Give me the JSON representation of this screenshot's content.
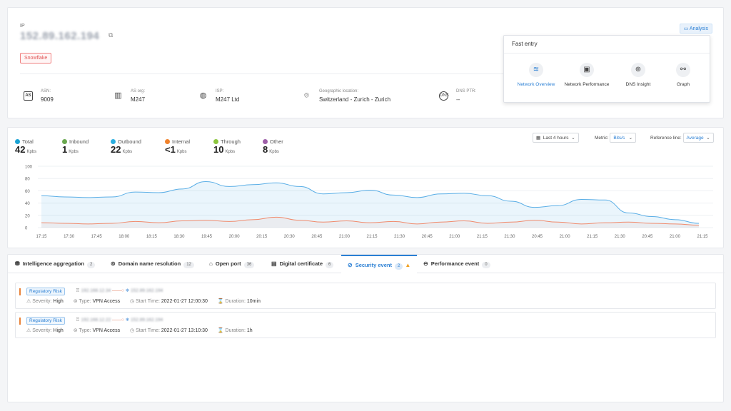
{
  "top": {
    "ip_label": "IP",
    "ip_value": "152.89.162.194",
    "tag": "Snowflake",
    "analysis_label": "Analysis",
    "info": [
      {
        "label": "ASN:",
        "value": "9009"
      },
      {
        "label": "AS org:",
        "value": "M247"
      },
      {
        "label": "ISP:",
        "value": "M247 Ltd"
      },
      {
        "label": "Geographic location:",
        "value": "Switzerland - Zurich - Zurich"
      },
      {
        "label": "DNS PTR:",
        "value": "--"
      }
    ],
    "fast_entry": {
      "title": "Fast entry",
      "items": [
        {
          "label": "Network Overview",
          "active": true
        },
        {
          "label": "Network Performance",
          "active": false
        },
        {
          "label": "DNS Insight",
          "active": false
        },
        {
          "label": "Graph",
          "active": false
        }
      ]
    }
  },
  "traffic": {
    "legend": [
      {
        "name": "Total",
        "value": "42",
        "unit": "Kpbs",
        "color": "#1aa3d4"
      },
      {
        "name": "Inbound",
        "value": "1",
        "unit": "Kpbs",
        "color": "#6aa84f"
      },
      {
        "name": "Outbound",
        "value": "22",
        "unit": "Kpbs",
        "color": "#29aee0"
      },
      {
        "name": "Internal",
        "value": "<1",
        "unit": "Kpbs",
        "color": "#f0822c"
      },
      {
        "name": "Through",
        "value": "10",
        "unit": "Kpbs",
        "color": "#8cc63e"
      },
      {
        "name": "Other",
        "value": "8",
        "unit": "Kpbs",
        "color": "#9e5fa8"
      }
    ],
    "controls": {
      "time_range": "Last 4 hours",
      "metric_label": "Metric:",
      "metric_value": "Bits/s",
      "reference_label": "Reference line:",
      "reference_value": "Average"
    }
  },
  "chart_data": {
    "type": "area",
    "ylim": [
      0,
      100
    ],
    "y_ticks": [
      0,
      20,
      40,
      60,
      80,
      100
    ],
    "x": [
      "17:15",
      "17:30",
      "17:45",
      "18:00",
      "18:15",
      "18:30",
      "19:45",
      "20:00",
      "20:15",
      "20:30",
      "20:45",
      "21:00",
      "21:15",
      "21:30",
      "20:45",
      "21:00",
      "21:15",
      "21:30",
      "20:45",
      "21:00",
      "21:15",
      "21:30",
      "20:45",
      "21:00",
      "21:15"
    ],
    "series": [
      {
        "color": "#5aaee6",
        "values": [
          52,
          50,
          49,
          50,
          58,
          57,
          63,
          75,
          67,
          70,
          73,
          67,
          55,
          57,
          61,
          53,
          49,
          55,
          56,
          52,
          43,
          33,
          36,
          46,
          45,
          24,
          18,
          13,
          7
        ]
      },
      {
        "color": "#f08a6c",
        "values": [
          8,
          7,
          6,
          7,
          10,
          8,
          11,
          12,
          10,
          13,
          17,
          12,
          9,
          11,
          8,
          10,
          6,
          9,
          11,
          7,
          9,
          12,
          9,
          6,
          8,
          9,
          7,
          6,
          4
        ]
      }
    ]
  },
  "tabs": [
    {
      "label": "Intelligence aggregation",
      "count": "2",
      "icon": "⛃",
      "active": false
    },
    {
      "label": "Domain name resolution",
      "count": "12",
      "icon": "⊚",
      "active": false
    },
    {
      "label": "Open port",
      "count": "36",
      "icon": "⌂",
      "active": false
    },
    {
      "label": "Digital certificate",
      "count": "6",
      "icon": "▤",
      "active": false
    },
    {
      "label": "Security event",
      "count": "2",
      "icon": "⊘",
      "active": true
    },
    {
      "label": "Performance event",
      "count": "0",
      "icon": "⊖",
      "active": false
    }
  ],
  "events": [
    {
      "risk": "Regulatory Risk",
      "src": "192.168.12.34",
      "dst": "152.89.162.194",
      "severity_label": "Severity:",
      "severity": "High",
      "type_label": "Type:",
      "type": "VPN Access",
      "start_label": "Start Time:",
      "start": "2022-01-27 12:00:30",
      "duration_label": "Duration:",
      "duration": "10min"
    },
    {
      "risk": "Regulatory Risk",
      "src": "192.168.12.22",
      "dst": "152.89.162.194",
      "severity_label": "Severity:",
      "severity": "High",
      "type_label": "Type:",
      "type": "VPN Access",
      "start_label": "Start Time:",
      "start": "2022-01-27 13:10:30",
      "duration_label": "Duration:",
      "duration": "1h"
    }
  ]
}
